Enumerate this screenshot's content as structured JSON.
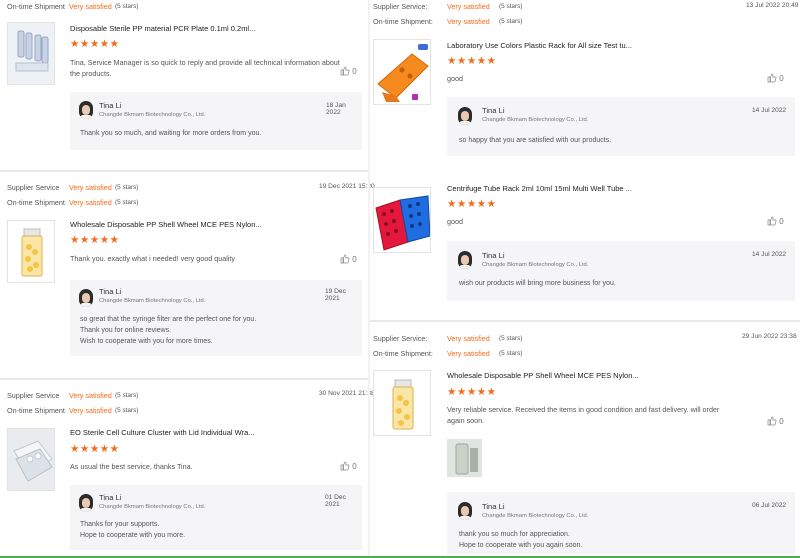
{
  "labels": {
    "supplier_service": "Supplier Service",
    "supplier_service_colon": "Supplier Service:",
    "ontime_shipment": "On-time Shipment",
    "ontime_shipment_colon": "On-time Shipment:"
  },
  "colors": {
    "accent": "#f26b1d",
    "reply_bg": "#f5f5f7",
    "divider": "#e8e8e8"
  },
  "left": [
    {
      "supplier_rating": "",
      "supplier_stars": "",
      "shipment_rating": "Very satisfied",
      "shipment_stars": "(5 stars)",
      "date": "",
      "product": "Disposable Sterile PP material PCR Plate 0.1ml 0.2ml...",
      "stars": "★★★★★",
      "comment": "Tina, Service Manager is so quick to reply and provide all technical information about the products.",
      "likes": "0",
      "reply": {
        "name": "Tina Li",
        "company": "Changde Bkmam Biotechnology Co., Ltd.",
        "date": "18 Jan 2022",
        "text": [
          "Thank you so much, and waiting for more orders from you."
        ]
      },
      "image": "pcr-plate-image"
    },
    {
      "supplier_rating": "Very satisfied",
      "supplier_stars": "(5 stars)",
      "shipment_rating": "Very satisfied",
      "shipment_stars": "(5 stars)",
      "date": "19 Dec 2021 15:20",
      "product": "Wholesale Disposable PP Shell Wheel MCE PES Nylon...",
      "stars": "★★★★★",
      "comment": "Thank you. exactly what i needed! very good quality",
      "likes": "0",
      "reply": {
        "name": "Tina Li",
        "company": "Changde Bkmam Biotechnology Co., Ltd.",
        "date": "19 Dec 2021",
        "text": [
          "so great that the syringe filter are the perfect one for you.",
          "Thank you for online reviews.",
          "Wish to cooperate with you for more times."
        ]
      },
      "image": "syringe-filter-jar-image"
    },
    {
      "supplier_rating": "Very satisfied",
      "supplier_stars": "(5 stars)",
      "shipment_rating": "Very satisfied",
      "shipment_stars": "(5 stars)",
      "date": "30 Nov 2021 21:38",
      "product": "EO Sterile Cell Culture Cluster with Lid Individual Wra...",
      "stars": "★★★★★",
      "comment": "As usual the best service, thanks Tina.",
      "likes": "0",
      "reply": {
        "name": "Tina Li",
        "company": "Changde Bkmam Biotechnology Co., Ltd.",
        "date": "01 Dec 2021",
        "text": [
          "Thanks for your supports.",
          "Hope to cooperate with you more."
        ]
      },
      "image": "cell-culture-plate-image"
    }
  ],
  "right": [
    {
      "supplier_rating": "Very satisfied",
      "supplier_stars": "(5 stars)",
      "shipment_rating": "Very satisfied",
      "shipment_stars": "(5 stars)",
      "date": "13 Jul 2022 20:49",
      "product": "Laboratory Use Colors Plastic Rack for All size Test tu...",
      "stars": "★★★★★",
      "comment": "good",
      "likes": "0",
      "reply": {
        "name": "Tina Li",
        "company": "Changde Bkmam Biotechnology Co., Ltd.",
        "date": "14 Jul 2022",
        "text": [
          "so happy that you are satisfied with our products."
        ]
      },
      "image": "orange-rack-image"
    },
    {
      "product": "Centrifuge Tube Rack 2ml 10ml 15ml Multi Well Tube ...",
      "stars": "★★★★★",
      "comment": "good",
      "likes": "0",
      "reply": {
        "name": "Tina Li",
        "company": "Changde Bkmam Biotechnology Co., Ltd.",
        "date": "14 Jul 2022",
        "text": [
          "wish our products will bring more business for you."
        ]
      },
      "image": "tube-rack-image"
    },
    {
      "supplier_rating": "Very satisfied",
      "supplier_stars": "(5 stars)",
      "shipment_rating": "Very satisfied",
      "shipment_stars": "(5 stars)",
      "date": "29 Jun 2022 23:38",
      "product": "Wholesale Disposable PP Shell Wheel MCE PES Nylon...",
      "stars": "★★★★★",
      "comment": "Very reliable service. Received the items in good condition and fast delivery. will order again soon.",
      "likes": "0",
      "reply": {
        "name": "Tina Li",
        "company": "Changde Bkmam Biotechnology Co., Ltd.",
        "date": "06 Jul 2022",
        "text": [
          "thank you so much for appreciation.",
          "Hope to cooperate with you again soon."
        ]
      },
      "image": "syringe-filter-jar-image"
    }
  ]
}
